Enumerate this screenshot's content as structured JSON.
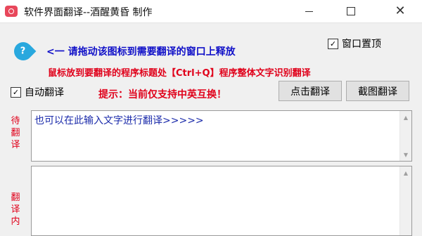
{
  "window": {
    "title": "软件界面翻译--酒醒黄昏 制作",
    "minimize_glyph": "",
    "close_glyph": "✕"
  },
  "drag_icon": {
    "glyph": "?"
  },
  "hints": {
    "drag_hint": "<一 请拖动该图标到需要翻译的窗口上释放",
    "mouse_hint": "鼠标放到要翻译的程序标题处【Ctrl+Q】程序整体文字识别翻译",
    "support_hint": "提示：当前仅支持中英互换！"
  },
  "options": {
    "topmost_label": "窗口置顶",
    "topmost_checked": true,
    "auto_translate_label": "自动翻译",
    "auto_translate_checked": true,
    "check_glyph": "✓"
  },
  "buttons": {
    "click_translate": "点击翻译",
    "screenshot_translate": "截图翻译"
  },
  "source": {
    "label_chars": [
      "待",
      "翻",
      "译"
    ],
    "text": "也可以在此输入文字进行翻译>>>>>"
  },
  "result": {
    "label_chars": [
      "翻",
      "译",
      "内"
    ],
    "text": ""
  },
  "scroll": {
    "up": "▲",
    "down": "▼"
  }
}
